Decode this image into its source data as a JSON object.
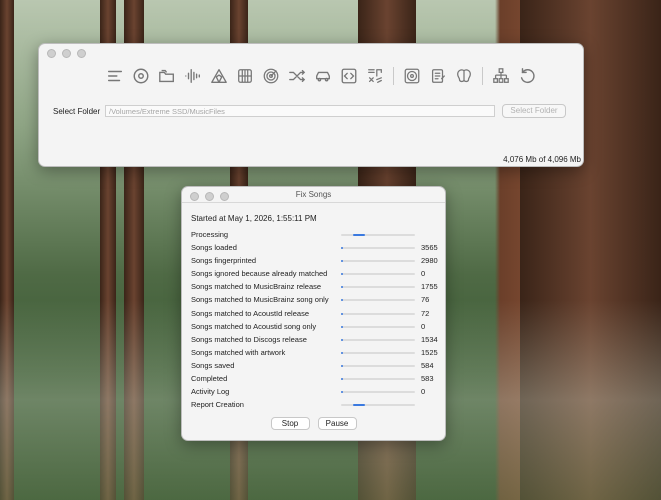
{
  "main_window": {
    "toolbar_icons": [
      "list-icon",
      "disc-icon",
      "folders-icon",
      "waveform-icon",
      "tent-icon",
      "grid-icon",
      "target-icon",
      "shuffle-icon",
      "car-icon",
      "code-icon",
      "music-tags-icon",
      "cd-icon",
      "clipboard-icon",
      "brain-icon",
      "flowchart-icon",
      "undo-icon"
    ],
    "select_folder_label": "Select Folder",
    "path_value": "/Volumes/Extreme SSD/MusicFiles",
    "select_folder_button": "Select Folder",
    "memory": "4,076 Mb of 4,096 Mb"
  },
  "fix_window": {
    "title": "Fix Songs",
    "started": "Started at May 1, 2026, 1:55:11 PM",
    "rows": [
      {
        "label": "Processing",
        "value": "",
        "indeterminate": true
      },
      {
        "label": "Songs loaded",
        "value": "3565"
      },
      {
        "label": "Songs fingerprinted",
        "value": "2980"
      },
      {
        "label": "Songs ignored because already matched",
        "value": "0"
      },
      {
        "label": "Songs matched to MusicBrainz release",
        "value": "1755"
      },
      {
        "label": "Songs matched to MusicBrainz song only",
        "value": "76"
      },
      {
        "label": "Songs matched to AcoustId release",
        "value": "72"
      },
      {
        "label": "Songs matched to Acoustid song only",
        "value": "0"
      },
      {
        "label": "Songs matched to Discogs release",
        "value": "1534"
      },
      {
        "label": "Songs matched with artwork",
        "value": "1525"
      },
      {
        "label": "Songs saved",
        "value": "584"
      },
      {
        "label": "Completed",
        "value": "583"
      },
      {
        "label": "Activity Log",
        "value": "0"
      },
      {
        "label": "Report Creation",
        "value": "",
        "indeterminate": true
      }
    ],
    "stop_button": "Stop",
    "pause_button": "Pause"
  }
}
